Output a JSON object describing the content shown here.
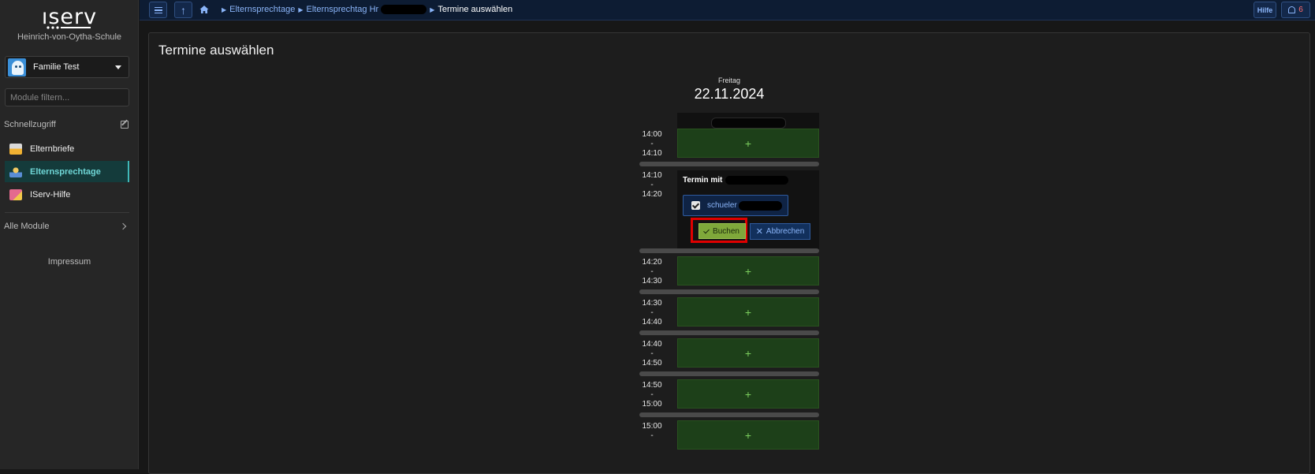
{
  "sidebar": {
    "logo": "ıserv",
    "school": "Heinrich-von-Oytha-Schule",
    "user": "Familie Test",
    "filter_placeholder": "Module filtern...",
    "quick_access": "Schnellzugriff",
    "items": [
      {
        "label": "Elternbriefe",
        "icon": "letters-icon",
        "active": false
      },
      {
        "label": "Elternsprechtage",
        "icon": "speech-day-icon",
        "active": true
      },
      {
        "label": "IServ-Hilfe",
        "icon": "help-icon",
        "active": false
      }
    ],
    "all_modules": "Alle Module",
    "impressum": "Impressum"
  },
  "topbar": {
    "breadcrumbs": [
      "Elternsprechtage",
      "Elternsprechtag Hr"
    ],
    "current": "Termine auswählen",
    "help": "Hilfe",
    "notifications": "6"
  },
  "main": {
    "title": "Termine auswählen",
    "weekday": "Freitag",
    "date": "22.11.2024",
    "slots": [
      {
        "from": "14:00",
        "dash": "-",
        "to": "14:10"
      },
      {
        "from": "14:10",
        "dash": "-",
        "to": "14:20"
      },
      {
        "from": "14:20",
        "dash": "-",
        "to": "14:30"
      },
      {
        "from": "14:30",
        "dash": "-",
        "to": "14:40"
      },
      {
        "from": "14:40",
        "dash": "-",
        "to": "14:50"
      },
      {
        "from": "14:50",
        "dash": "-",
        "to": "15:00"
      },
      {
        "from": "15:00",
        "dash": "-",
        "to": ""
      }
    ],
    "plus": "+",
    "booking": {
      "termin_label": "Termin mit",
      "student": "schueler",
      "book": "Buchen",
      "cancel": "Abbrechen"
    }
  },
  "colors": {
    "accent": "#8ab4f8",
    "slot_green": "#1d4019",
    "book_green": "#7fa83a",
    "highlight_red": "#e00000",
    "active_teal": "#6fd6d6"
  }
}
